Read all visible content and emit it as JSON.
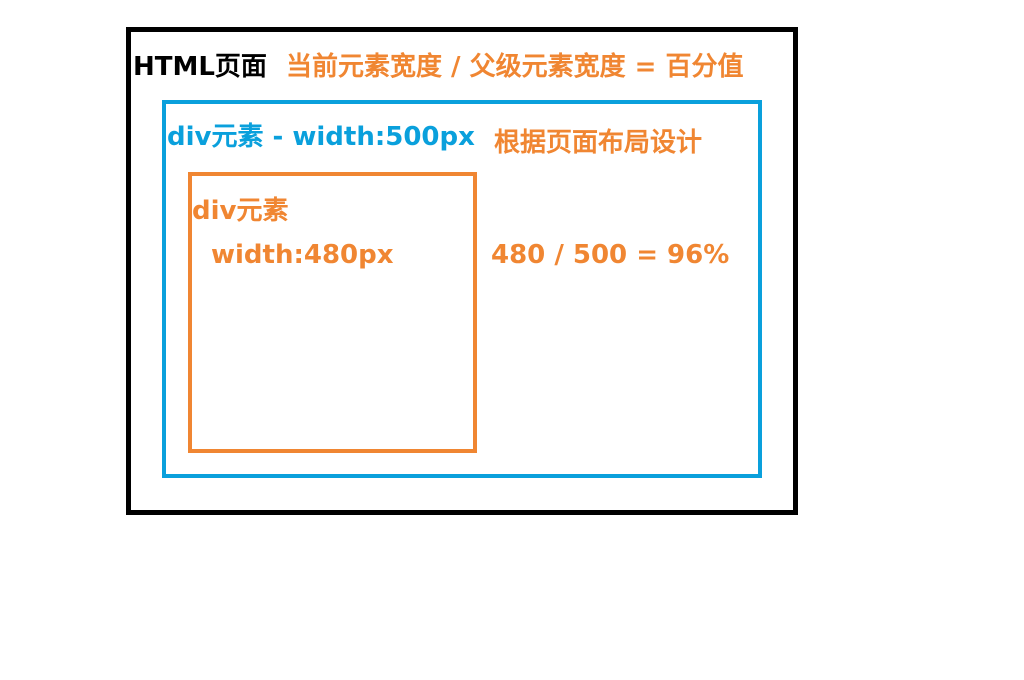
{
  "labels": {
    "page": "HTML页面",
    "formula": "当前元素宽度 / 父级元素宽度 = 百分值",
    "parent_element": "div元素 - width:500px",
    "design_note": "根据页面布局设计",
    "child_element": "div元素",
    "child_width": "width:480px",
    "calculation": "480 / 500 = 96%"
  },
  "colors": {
    "page_border": "#000000",
    "parent_border": "#0aa0dc",
    "child_border": "#f08632",
    "accent_text": "#f08632"
  }
}
